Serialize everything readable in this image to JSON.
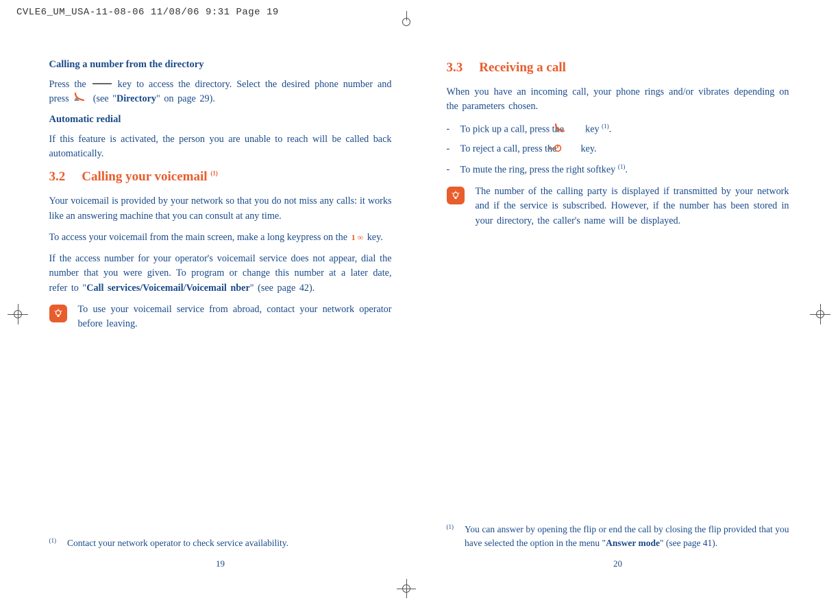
{
  "headerLine": "CVLE6_UM_USA-11-08-06  11/08/06  9:31  Page 19",
  "left": {
    "subhead1": "Calling a number from the directory",
    "p1a": "Press the ",
    "p1b": " key to access the directory. Select the desired phone number and press ",
    "p1c": " (see \"",
    "p1bold": "Directory",
    "p1d": "\" on page 29).",
    "subhead2": "Automatic redial",
    "p2": "If this feature is activated, the person you are unable to reach will be called back automatically.",
    "sec32num": "3.2",
    "sec32title": "Calling your voicemail ",
    "sec32sup": "(1)",
    "p3": "Your voicemail is provided by your network so that you do not miss any calls: it works like an answering machine that you can consult at any time.",
    "p4a": "To access your voicemail from the main screen, make a long keypress on the ",
    "p4b": " key.",
    "keyvm": "1  ∞",
    "p5a": "If the access number for your operator's voicemail service does not appear, dial the number that you were given. To program or change this number at a later date, refer to \"",
    "p5bold": "Call services/Voicemail/Voicemail nber",
    "p5b": "\" (see page 42).",
    "tip": "To use your voicemail service from abroad, contact your network operator before leaving.",
    "fnNum": "(1)",
    "fnText": "Contact your network operator to check service availability.",
    "pageNum": "19"
  },
  "right": {
    "sec33num": "3.3",
    "sec33title": "Receiving a call",
    "p1": "When you have an incoming call, your phone rings and/or vibrates depending on the parameters chosen.",
    "li1a": "To pick up a call, press the ",
    "li1b": " key ",
    "li1sup": "(1)",
    "li1c": ".",
    "li2a": "To reject a call, press the ",
    "li2b": " key.",
    "li3a": "To mute the ring, press the right softkey ",
    "li3sup": "(1)",
    "li3b": ".",
    "tip": "The number of the calling party is displayed if transmitted by your network and if the service is subscribed. However, if the number has been stored in your directory, the caller's name will be displayed.",
    "fnNum": "(1)",
    "fnTextA": "You can answer by opening the flip or end the call by closing the flip provided that you have selected the option in the menu \"",
    "fnBold": "Answer mode",
    "fnTextB": "\" (see page 41).",
    "pageNum": "20"
  }
}
